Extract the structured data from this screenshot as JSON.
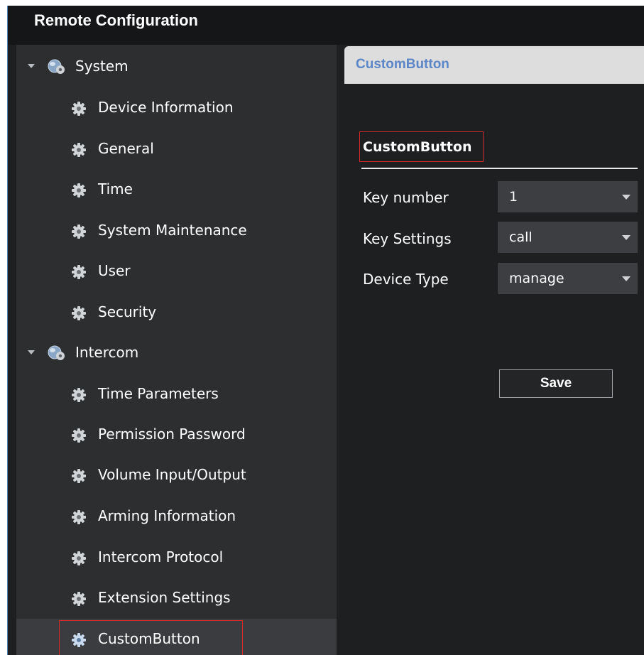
{
  "window": {
    "title": "Remote Configuration"
  },
  "sidebar": {
    "groups": [
      {
        "label": "System",
        "icon": "gear-group-icon",
        "items": [
          {
            "label": "Device Information",
            "icon": "gear-icon"
          },
          {
            "label": "General",
            "icon": "gear-icon"
          },
          {
            "label": "Time",
            "icon": "gear-icon"
          },
          {
            "label": "System Maintenance",
            "icon": "gear-icon"
          },
          {
            "label": "User",
            "icon": "gear-icon"
          },
          {
            "label": "Security",
            "icon": "gear-icon"
          }
        ]
      },
      {
        "label": "Intercom",
        "icon": "gear-group-icon",
        "items": [
          {
            "label": "Time Parameters",
            "icon": "gear-icon"
          },
          {
            "label": "Permission Password",
            "icon": "gear-icon"
          },
          {
            "label": "Volume Input/Output",
            "icon": "gear-icon"
          },
          {
            "label": "Arming Information",
            "icon": "gear-icon"
          },
          {
            "label": "Intercom Protocol",
            "icon": "gear-icon"
          },
          {
            "label": "Extension Settings",
            "icon": "gear-icon"
          },
          {
            "label": "CustomButton",
            "icon": "gear-icon",
            "selected": true
          }
        ]
      }
    ]
  },
  "main": {
    "tab_label": "CustomButton",
    "section_title": "CustomButton",
    "fields": [
      {
        "label": "Key number",
        "value": "1"
      },
      {
        "label": "Key Settings",
        "value": "call"
      },
      {
        "label": "Device Type",
        "value": "manage"
      }
    ],
    "save_label": "Save"
  },
  "colors": {
    "window_bg": "#1d1f21",
    "sidebar_bg": "#2c2e30",
    "tab_bg": "#dddddd",
    "tab_text": "#5b86c8",
    "highlight_border": "#d42a2a"
  }
}
